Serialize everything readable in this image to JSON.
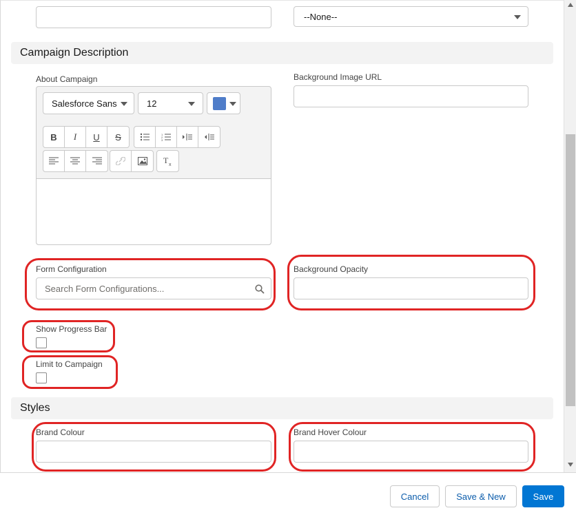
{
  "top_row": {
    "type_select_value": "--None--"
  },
  "section_campaign_description": {
    "title": "Campaign Description",
    "about_label": "About Campaign",
    "font_family_value": "Salesforce Sans",
    "font_size_value": "12",
    "color_swatch": "#4f7dc9",
    "background_image_url_label": "Background Image URL",
    "form_configuration_label": "Form Configuration",
    "form_configuration_placeholder": "Search Form Configurations...",
    "background_opacity_label": "Background Opacity",
    "show_progress_bar_label": "Show Progress Bar",
    "limit_to_campaign_label": "Limit to Campaign"
  },
  "section_styles": {
    "title": "Styles",
    "brand_colour_label": "Brand Colour",
    "brand_hover_colour_label": "Brand Hover Colour"
  },
  "footer": {
    "cancel_label": "Cancel",
    "save_new_label": "Save & New",
    "save_label": "Save"
  },
  "colors": {
    "brand": "#0176d3",
    "highlight": "#e02424"
  }
}
